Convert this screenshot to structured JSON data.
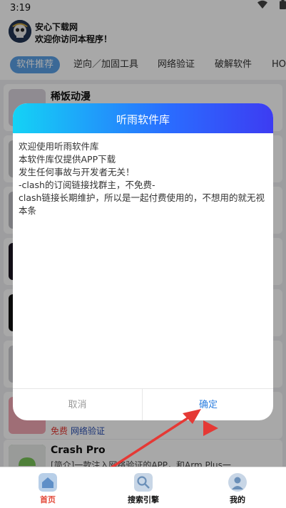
{
  "status_bar": {
    "time": "3:19"
  },
  "header": {
    "title": "安心下载网",
    "subtitle": "欢迎你访问本程序！"
  },
  "tabs": [
    {
      "label": "软件推荐",
      "active": true
    },
    {
      "label": "逆向／加固工具",
      "active": false
    },
    {
      "label": "网络验证",
      "active": false
    },
    {
      "label": "破解软件",
      "active": false
    },
    {
      "label": "HO",
      "active": false
    }
  ],
  "list": {
    "items": [
      {
        "name": "稀饭动漫",
        "desc": "",
        "tags": []
      },
      {
        "name": "",
        "desc": "",
        "tags": [
          "免费",
          "网络验证"
        ]
      },
      {
        "name": "Crash Pro",
        "desc": "[简介]一款注入网络验证的APP，和Arm Plus一...",
        "tags": []
      }
    ]
  },
  "dialog": {
    "title": "听雨软件库",
    "lines": [
      "欢迎使用听雨软件库",
      "本软件库仅提供APP下载",
      "发生任何事故与开发者无关！",
      "-clash的订阅链接找群主，不免费-",
      "clash链接长期维护，所以是一起付费使用的，不想用的就无视本条"
    ],
    "cancel_label": "取消",
    "confirm_label": "确定"
  },
  "bottom_nav": [
    {
      "label": "首页",
      "icon": "home-icon",
      "active": true
    },
    {
      "label": "搜索引擎",
      "icon": "search-engine-icon",
      "active": false
    },
    {
      "label": "我的",
      "icon": "profile-icon",
      "active": false
    }
  ],
  "colors": {
    "accent": "#5aa0e6",
    "dialog_gradient_start": "#14d3f5",
    "dialog_gradient_end": "#3d3cf2",
    "confirm": "#2e7fe0",
    "arrow": "#e53935",
    "nav_active": "#e34a3a"
  }
}
